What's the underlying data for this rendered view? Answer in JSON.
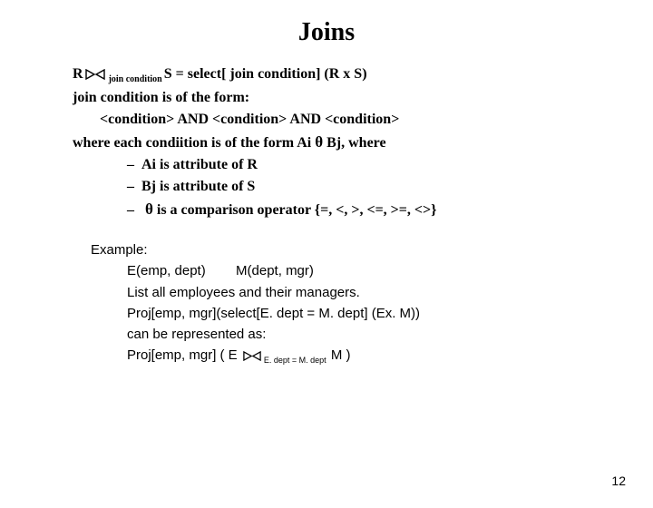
{
  "title": "Joins",
  "def": {
    "prefix": "R",
    "sub": "join condition",
    "rest": "S = select[ join condition] (R x S)"
  },
  "form_intro": "join condition is of the form:",
  "form_expr": "<condition> AND <condition> AND <condition>",
  "where_line_a": "where each condiition is of the form Ai ",
  "where_line_b": " Bj, where",
  "bul_dash": "–",
  "bul_a": "Ai is attribute of R",
  "bul_b": "Bj is attribute of S",
  "bul_c_a": " is a comparison operator {=, <, >, <=, >=, <>}",
  "theta": "θ",
  "example": {
    "label": "Example:",
    "l1": "E(emp, dept)        M(dept, mgr)",
    "l2": "List all employees and their managers.",
    "l3": "Proj[emp, mgr](select[E. dept = M. dept] (Ex. M))",
    "l4": "can be represented as:",
    "l5a": "Proj[emp, mgr] ( E ",
    "l5sub": "E. dept = M. dept",
    "l5b": " M )"
  },
  "page": "12"
}
